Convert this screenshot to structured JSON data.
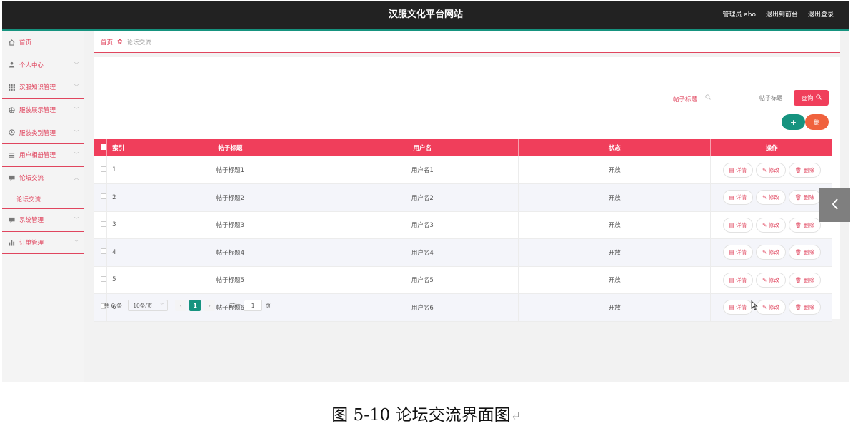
{
  "header": {
    "app_title": "汉服文化平台网站",
    "admin_label": "管理员 abo",
    "front_label": "退出到前台",
    "logout_label": "退出登录"
  },
  "sidebar": {
    "items": [
      {
        "label": "首页",
        "icon": "home-icon"
      },
      {
        "label": "个人中心",
        "icon": "user-icon"
      },
      {
        "label": "汉服知识管理",
        "icon": "grid-icon"
      },
      {
        "label": "服装展示管理",
        "icon": "circle-icon"
      },
      {
        "label": "服装类别管理",
        "icon": "clock-icon"
      },
      {
        "label": "用户相册管理",
        "icon": "list-icon"
      },
      {
        "label": "论坛交流",
        "icon": "chat-icon",
        "expanded": true
      },
      {
        "label": "系统管理",
        "icon": "chat-icon"
      },
      {
        "label": "订单管理",
        "icon": "chart-icon"
      }
    ],
    "sub_item": "论坛交流"
  },
  "breadcrumb": {
    "home": "首页",
    "current": "论坛交流"
  },
  "search": {
    "label": "帖子标题",
    "placeholder": "帖子标题",
    "query_label": "查询"
  },
  "toolbar": {
    "add_label": "+",
    "delete_label": "删"
  },
  "table": {
    "headers": [
      "索引",
      "帖子标题",
      "用户名",
      "状态",
      "操作"
    ],
    "rows": [
      {
        "index": "1",
        "title": "帖子标题1",
        "user": "用户名1",
        "status": "开放"
      },
      {
        "index": "2",
        "title": "帖子标题2",
        "user": "用户名2",
        "status": "开放"
      },
      {
        "index": "3",
        "title": "帖子标题3",
        "user": "用户名3",
        "status": "开放"
      },
      {
        "index": "4",
        "title": "帖子标题4",
        "user": "用户名4",
        "status": "开放"
      },
      {
        "index": "5",
        "title": "帖子标题5",
        "user": "用户名5",
        "status": "开放"
      },
      {
        "index": "6",
        "title": "帖子标题6",
        "user": "用户名6",
        "status": "开放"
      }
    ],
    "actions": {
      "detail": "详情",
      "edit": "修改",
      "delete": "删除"
    }
  },
  "pagination": {
    "total": "共 6 条",
    "page_size": "10条/页",
    "current_page": "1",
    "goto_label": "前往",
    "goto_value": "1",
    "page_unit": "页"
  },
  "caption": "图 5-10 论坛交流界面图",
  "colors": {
    "accent": "#f03e5b",
    "teal": "#16937f",
    "header": "#222222",
    "delete_orange": "#f0623e"
  }
}
